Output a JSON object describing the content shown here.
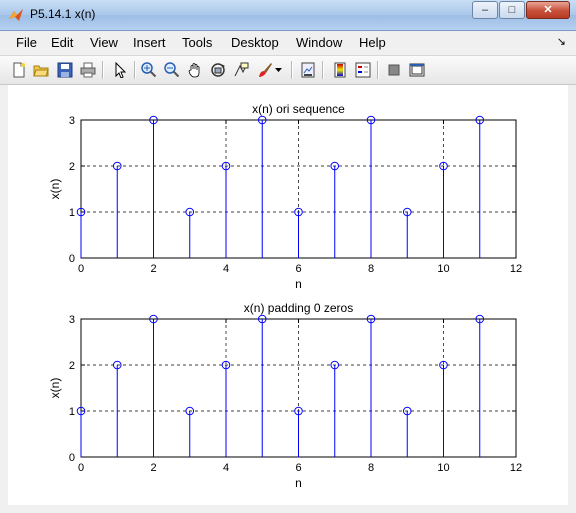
{
  "window": {
    "title": "P5.14.1 x(n)",
    "minimize": "–",
    "maximize": "□",
    "close": "✕"
  },
  "menu": {
    "items": [
      "File",
      "Edit",
      "View",
      "Insert",
      "Tools",
      "Desktop",
      "Window",
      "Help"
    ]
  },
  "toolbar": {
    "icons": [
      "new-figure-icon",
      "open-file-icon",
      "save-icon",
      "print-icon",
      "select-arrow-icon",
      "zoom-in-icon",
      "zoom-out-icon",
      "pan-icon",
      "rotate-3d-icon",
      "data-cursor-icon",
      "brush-icon",
      "link-plot-icon",
      "colorbar-icon",
      "legend-icon",
      "hide-plot-tools-icon",
      "show-plot-tools-icon"
    ]
  },
  "colors": {
    "stem": "#0000ff",
    "grid": "#000000"
  },
  "chart_data": [
    {
      "type": "stem",
      "title": "x(n) ori sequence",
      "xlabel": "n",
      "ylabel": "x(n)",
      "xlim": [
        0,
        12
      ],
      "ylim": [
        0,
        3
      ],
      "xticks": [
        0,
        2,
        4,
        6,
        8,
        10,
        12
      ],
      "yticks": [
        0,
        1,
        2,
        3
      ],
      "grid": true,
      "x": [
        0,
        1,
        2,
        3,
        4,
        5,
        6,
        7,
        8,
        9,
        10,
        11
      ],
      "values": [
        1,
        2,
        3,
        1,
        2,
        3,
        1,
        2,
        3,
        1,
        2,
        3
      ]
    },
    {
      "type": "stem",
      "title": "x(n) padding 0 zeros",
      "xlabel": "n",
      "ylabel": "x(n)",
      "xlim": [
        0,
        12
      ],
      "ylim": [
        0,
        3
      ],
      "xticks": [
        0,
        2,
        4,
        6,
        8,
        10,
        12
      ],
      "yticks": [
        0,
        1,
        2,
        3
      ],
      "grid": true,
      "x": [
        0,
        1,
        2,
        3,
        4,
        5,
        6,
        7,
        8,
        9,
        10,
        11
      ],
      "values": [
        1,
        2,
        3,
        1,
        2,
        3,
        1,
        2,
        3,
        1,
        2,
        3
      ]
    }
  ]
}
